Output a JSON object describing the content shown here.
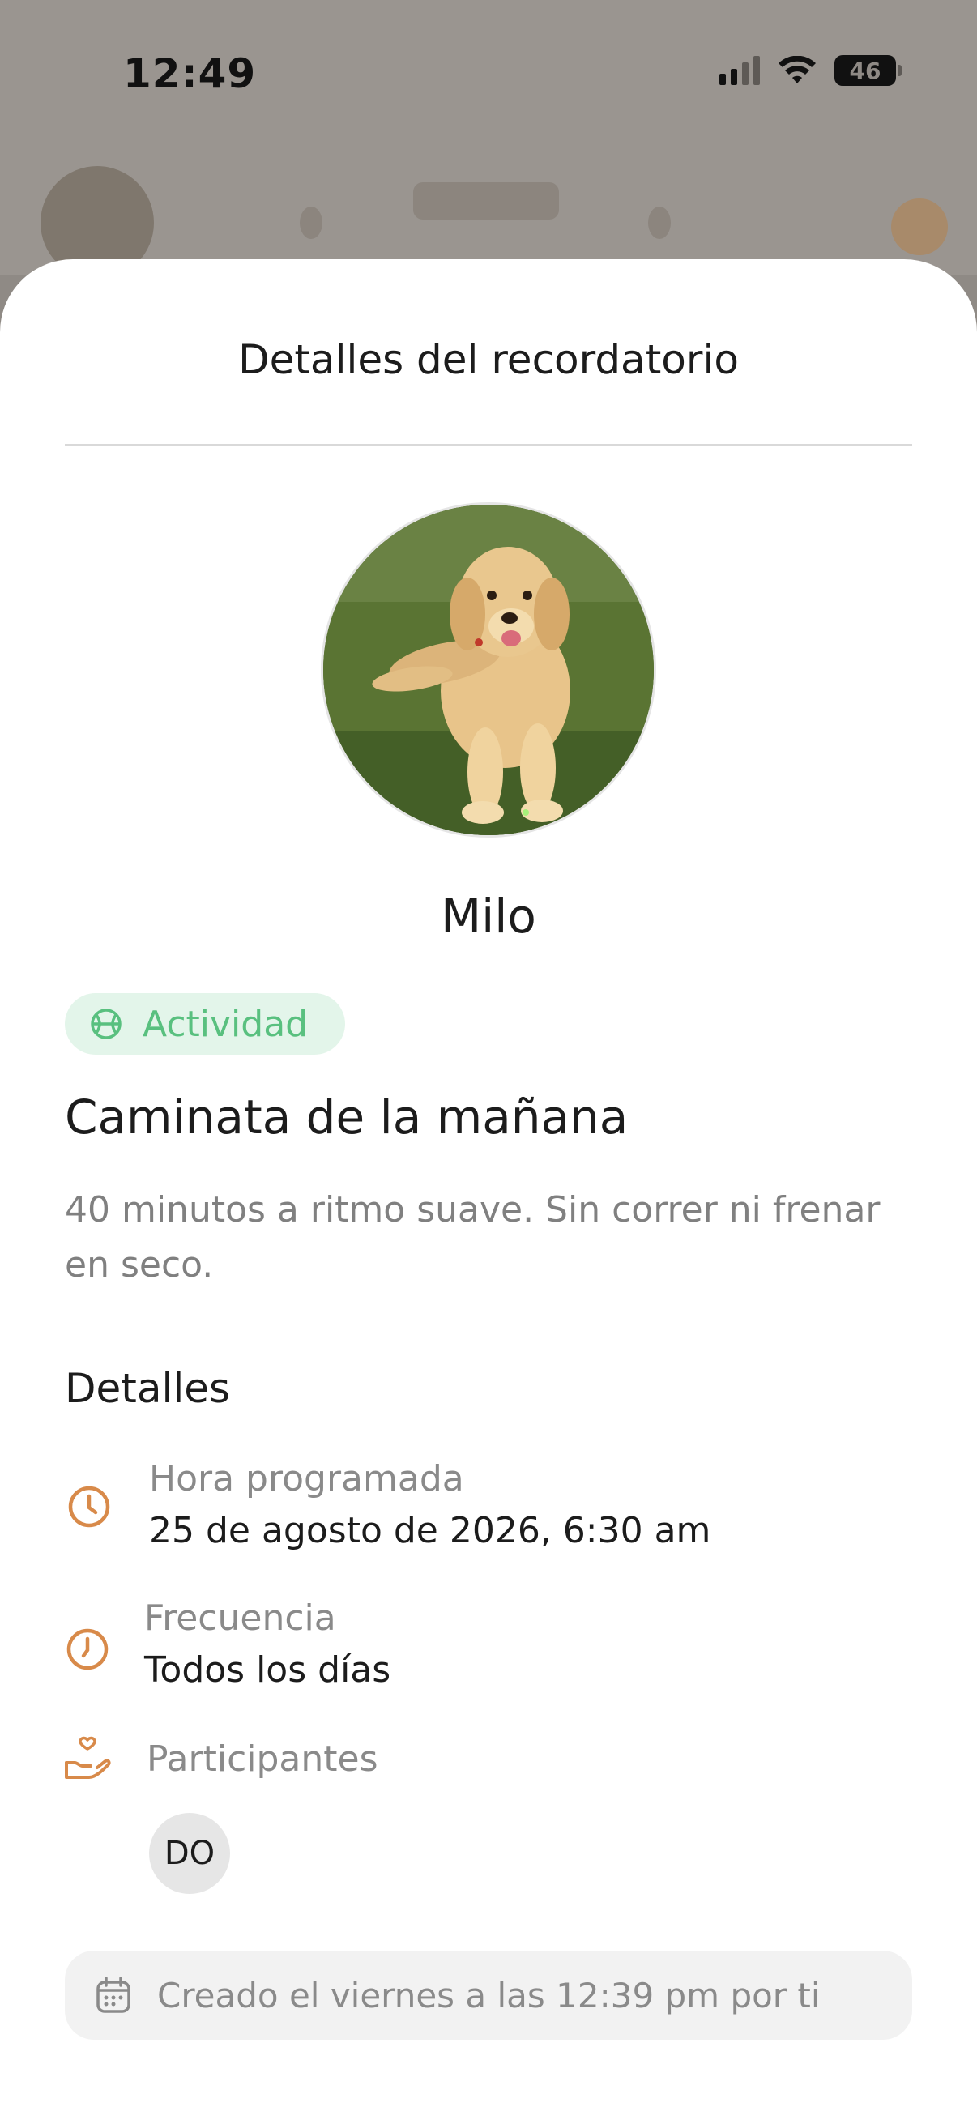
{
  "status_bar": {
    "time": "12:49",
    "battery": "46",
    "icons": [
      "cellular-signal-icon",
      "wifi-icon",
      "battery-icon"
    ]
  },
  "sheet": {
    "title": "Detalles del recordatorio"
  },
  "pet": {
    "name": "Milo",
    "photo": "golden-retriever-puppy-photo"
  },
  "category": {
    "label": "Actividad",
    "icon": "activity-ball-icon",
    "color": "#59c07f",
    "background": "#e3f5ea"
  },
  "reminder": {
    "title": "Caminata de la mañana",
    "description": "40 minutos a ritmo suave. Sin correr ni frenar en seco."
  },
  "details": {
    "section_title": "Detalles",
    "scheduled": {
      "label": "Hora programada",
      "value": "25 de agosto de 2026, 6:30 am",
      "icon": "clock-icon"
    },
    "frequency": {
      "label": "Frecuencia",
      "value": "Todos los días",
      "icon": "clock-icon"
    },
    "participants": {
      "label": "Participantes",
      "icon": "heart-hand-icon",
      "members": [
        "DO"
      ]
    }
  },
  "footer": {
    "created_text": "Creado el viernes a las 12:39 pm por ti",
    "icon": "calendar-icon"
  },
  "colors": {
    "accent_orange": "#d88a4a",
    "activity_green": "#59c07f"
  }
}
